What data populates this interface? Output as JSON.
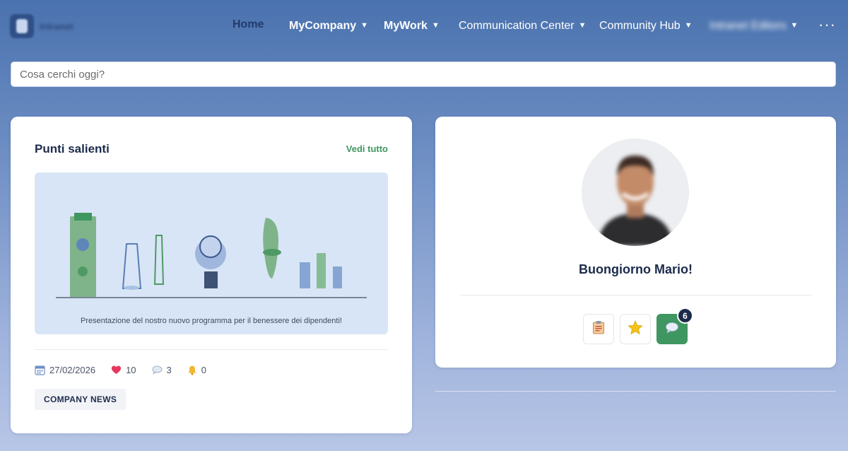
{
  "nav": {
    "items": [
      {
        "label": "Home",
        "caret": ""
      },
      {
        "label": "MyCompany",
        "caret": "▼"
      },
      {
        "label": "MyWork",
        "caret": "▼"
      },
      {
        "label": "Communication Center",
        "caret": "▼"
      },
      {
        "label": "Community Hub",
        "caret": "▼"
      },
      {
        "label": "Intranet Editors",
        "caret": "▼"
      }
    ],
    "more_label": "···",
    "logo_icon": "app-logo-icon",
    "logo_text": "Intranet"
  },
  "search": {
    "placeholder": "Cosa cerchi oggi?",
    "value": ""
  },
  "highlights": {
    "title": "Punti salienti",
    "see_all_label": "Vedi tutto",
    "caption": "Presentazione del nostro nuovo programma per il benessere dei dipendenti!",
    "date": "27/02/2026",
    "likes": "10",
    "comments": "3",
    "notifications": "0",
    "tag_label": "COMPANY NEWS",
    "icons": [
      "calendar-icon",
      "heart-icon",
      "comment-icon",
      "bell-icon"
    ]
  },
  "profile": {
    "greeting": "Buongiorno Mario!",
    "quick_actions": [
      {
        "icon": "clipboard-icon"
      },
      {
        "icon": "star-icon"
      },
      {
        "icon": "chat-icon"
      }
    ],
    "chat_badge": "6"
  },
  "colors": {
    "accent_green": "#3f9660",
    "dark_navy": "#1c2b4b",
    "nav_active": "#1f3b6e"
  }
}
